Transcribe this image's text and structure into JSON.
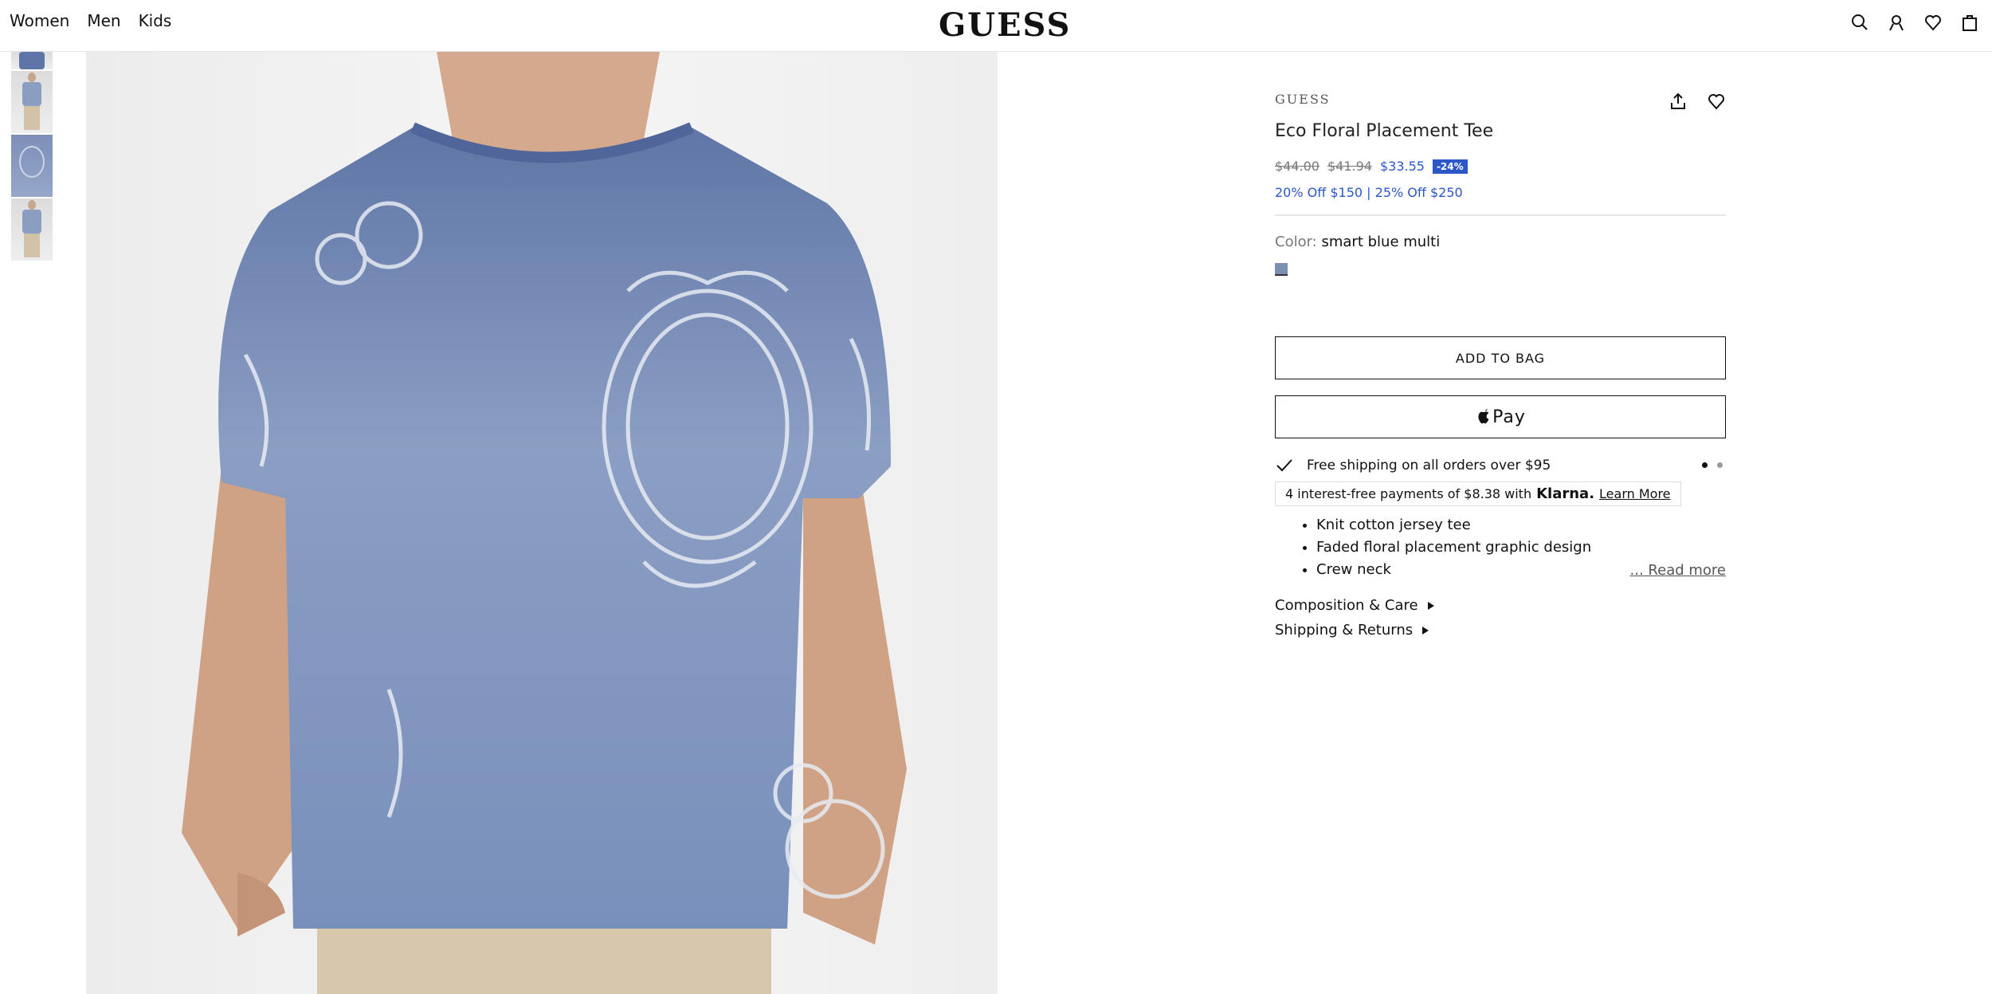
{
  "nav": {
    "items": [
      "Women",
      "Men",
      "Kids"
    ]
  },
  "logo": "GUESS",
  "header_icons": [
    "search-icon",
    "account-icon",
    "wishlist-icon",
    "bag-icon"
  ],
  "product": {
    "brand": "GUESS",
    "title": "Eco Floral Placement Tee",
    "price_original": "$44.00",
    "price_previous": "$41.94",
    "price_sale": "$33.55",
    "discount_badge": "-24%",
    "promo": "20% Off $150 | 25% Off $250",
    "color_label": "Color:",
    "color_value": "smart blue multi",
    "add_to_bag": "ADD TO BAG",
    "apple_pay": "Pay",
    "shipping": "Free shipping on all orders over $95",
    "klarna": {
      "text": "4 interest-free payments of $8.38 with",
      "brand": "Klarna.",
      "link": "Learn More"
    },
    "features": [
      "Knit cotton jersey tee",
      "Faded floral placement graphic design",
      "Crew neck"
    ],
    "read_more": "... Read more",
    "accordions": [
      "Composition & Care",
      "Shipping & Returns"
    ]
  },
  "colors": {
    "accent": "#2b57c7",
    "swatch": "#7b8fb1",
    "shirt": "#6f84ab"
  }
}
